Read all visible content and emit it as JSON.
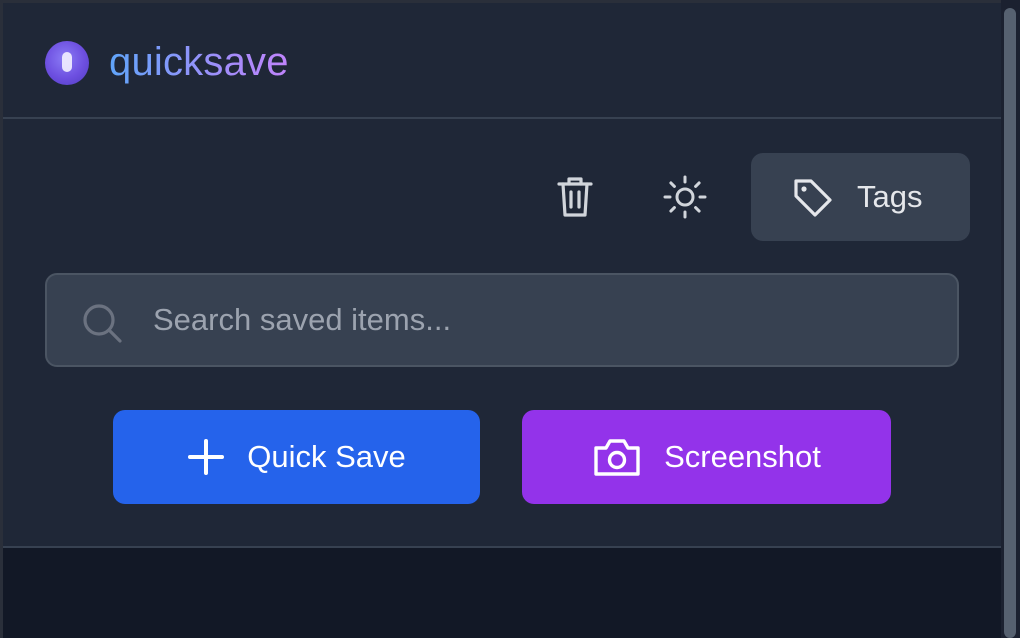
{
  "app": {
    "title": "quicksave",
    "logo_icon": "quicksave-logo-icon"
  },
  "toolbar": {
    "delete_icon": "trash-icon",
    "theme_icon": "sun-icon",
    "tags_icon": "tag-icon",
    "tags_label": "Tags"
  },
  "search": {
    "icon": "search-icon",
    "placeholder": "Search saved items...",
    "value": ""
  },
  "actions": {
    "quick_save_icon": "plus-icon",
    "quick_save_label": "Quick Save",
    "screenshot_icon": "camera-icon",
    "screenshot_label": "Screenshot"
  },
  "colors": {
    "background": "#1f2737",
    "surface": "#374151",
    "quick_save": "#2563eb",
    "screenshot": "#9333ea",
    "title_gradient_start": "#60a5fa",
    "title_gradient_end": "#c084fc"
  }
}
